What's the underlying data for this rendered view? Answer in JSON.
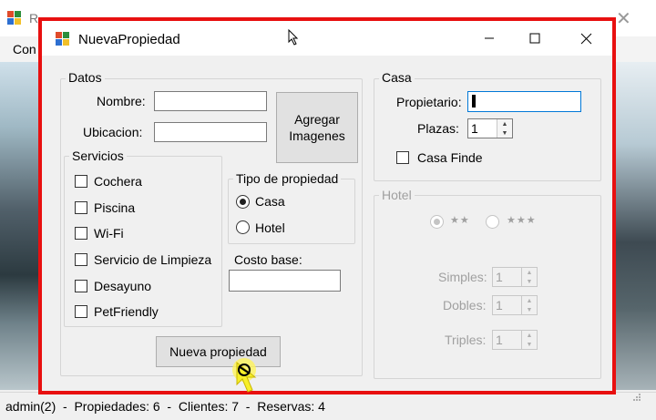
{
  "background": {
    "title": "R",
    "subtitle": "...",
    "menu": "Con",
    "status": "admin(2)  -  Propiedades: 6  -  Clientes: 7  -  Reservas: 4"
  },
  "dialog": {
    "title": "NuevaPropiedad",
    "controls": {
      "minimize": "—",
      "maximize": "☐",
      "close": "✕"
    },
    "datos": {
      "label": "Datos",
      "nombre_label": "Nombre:",
      "nombre_value": "",
      "ubicacion_label": "Ubicacion:",
      "ubicacion_value": "",
      "agregar_imagenes": "Agregar\nImagenes"
    },
    "servicios": {
      "label": "Servicios",
      "items": [
        {
          "label": "Cochera",
          "checked": false
        },
        {
          "label": "Piscina",
          "checked": false
        },
        {
          "label": "Wi-Fi",
          "checked": false
        },
        {
          "label": "Servicio de Limpieza",
          "checked": false
        },
        {
          "label": "Desayuno",
          "checked": false
        },
        {
          "label": "PetFriendly",
          "checked": false
        }
      ]
    },
    "tipo": {
      "label": "Tipo de propiedad",
      "options": [
        {
          "label": "Casa",
          "selected": true
        },
        {
          "label": "Hotel",
          "selected": false
        }
      ]
    },
    "costo": {
      "label": "Costo base:",
      "value": ""
    },
    "nueva_button": "Nueva propiedad",
    "casa": {
      "label": "Casa",
      "propietario_label": "Propietario:",
      "propietario_value": "",
      "plazas_label": "Plazas:",
      "plazas_value": "1",
      "casa_finde_label": "Casa Finde",
      "casa_finde_checked": false
    },
    "hotel": {
      "label": "Hotel",
      "stars": [
        {
          "label": "★★",
          "selected": true
        },
        {
          "label": "★★★",
          "selected": false
        }
      ],
      "simples_label": "Simples:",
      "simples_value": "1",
      "dobles_label": "Dobles:",
      "dobles_value": "1",
      "triples_label": "Triples:",
      "triples_value": "1"
    }
  },
  "colors": {
    "highlight_border": "#e81010",
    "focus_border": "#0078d7",
    "disabled_text": "#a0a0a0"
  }
}
